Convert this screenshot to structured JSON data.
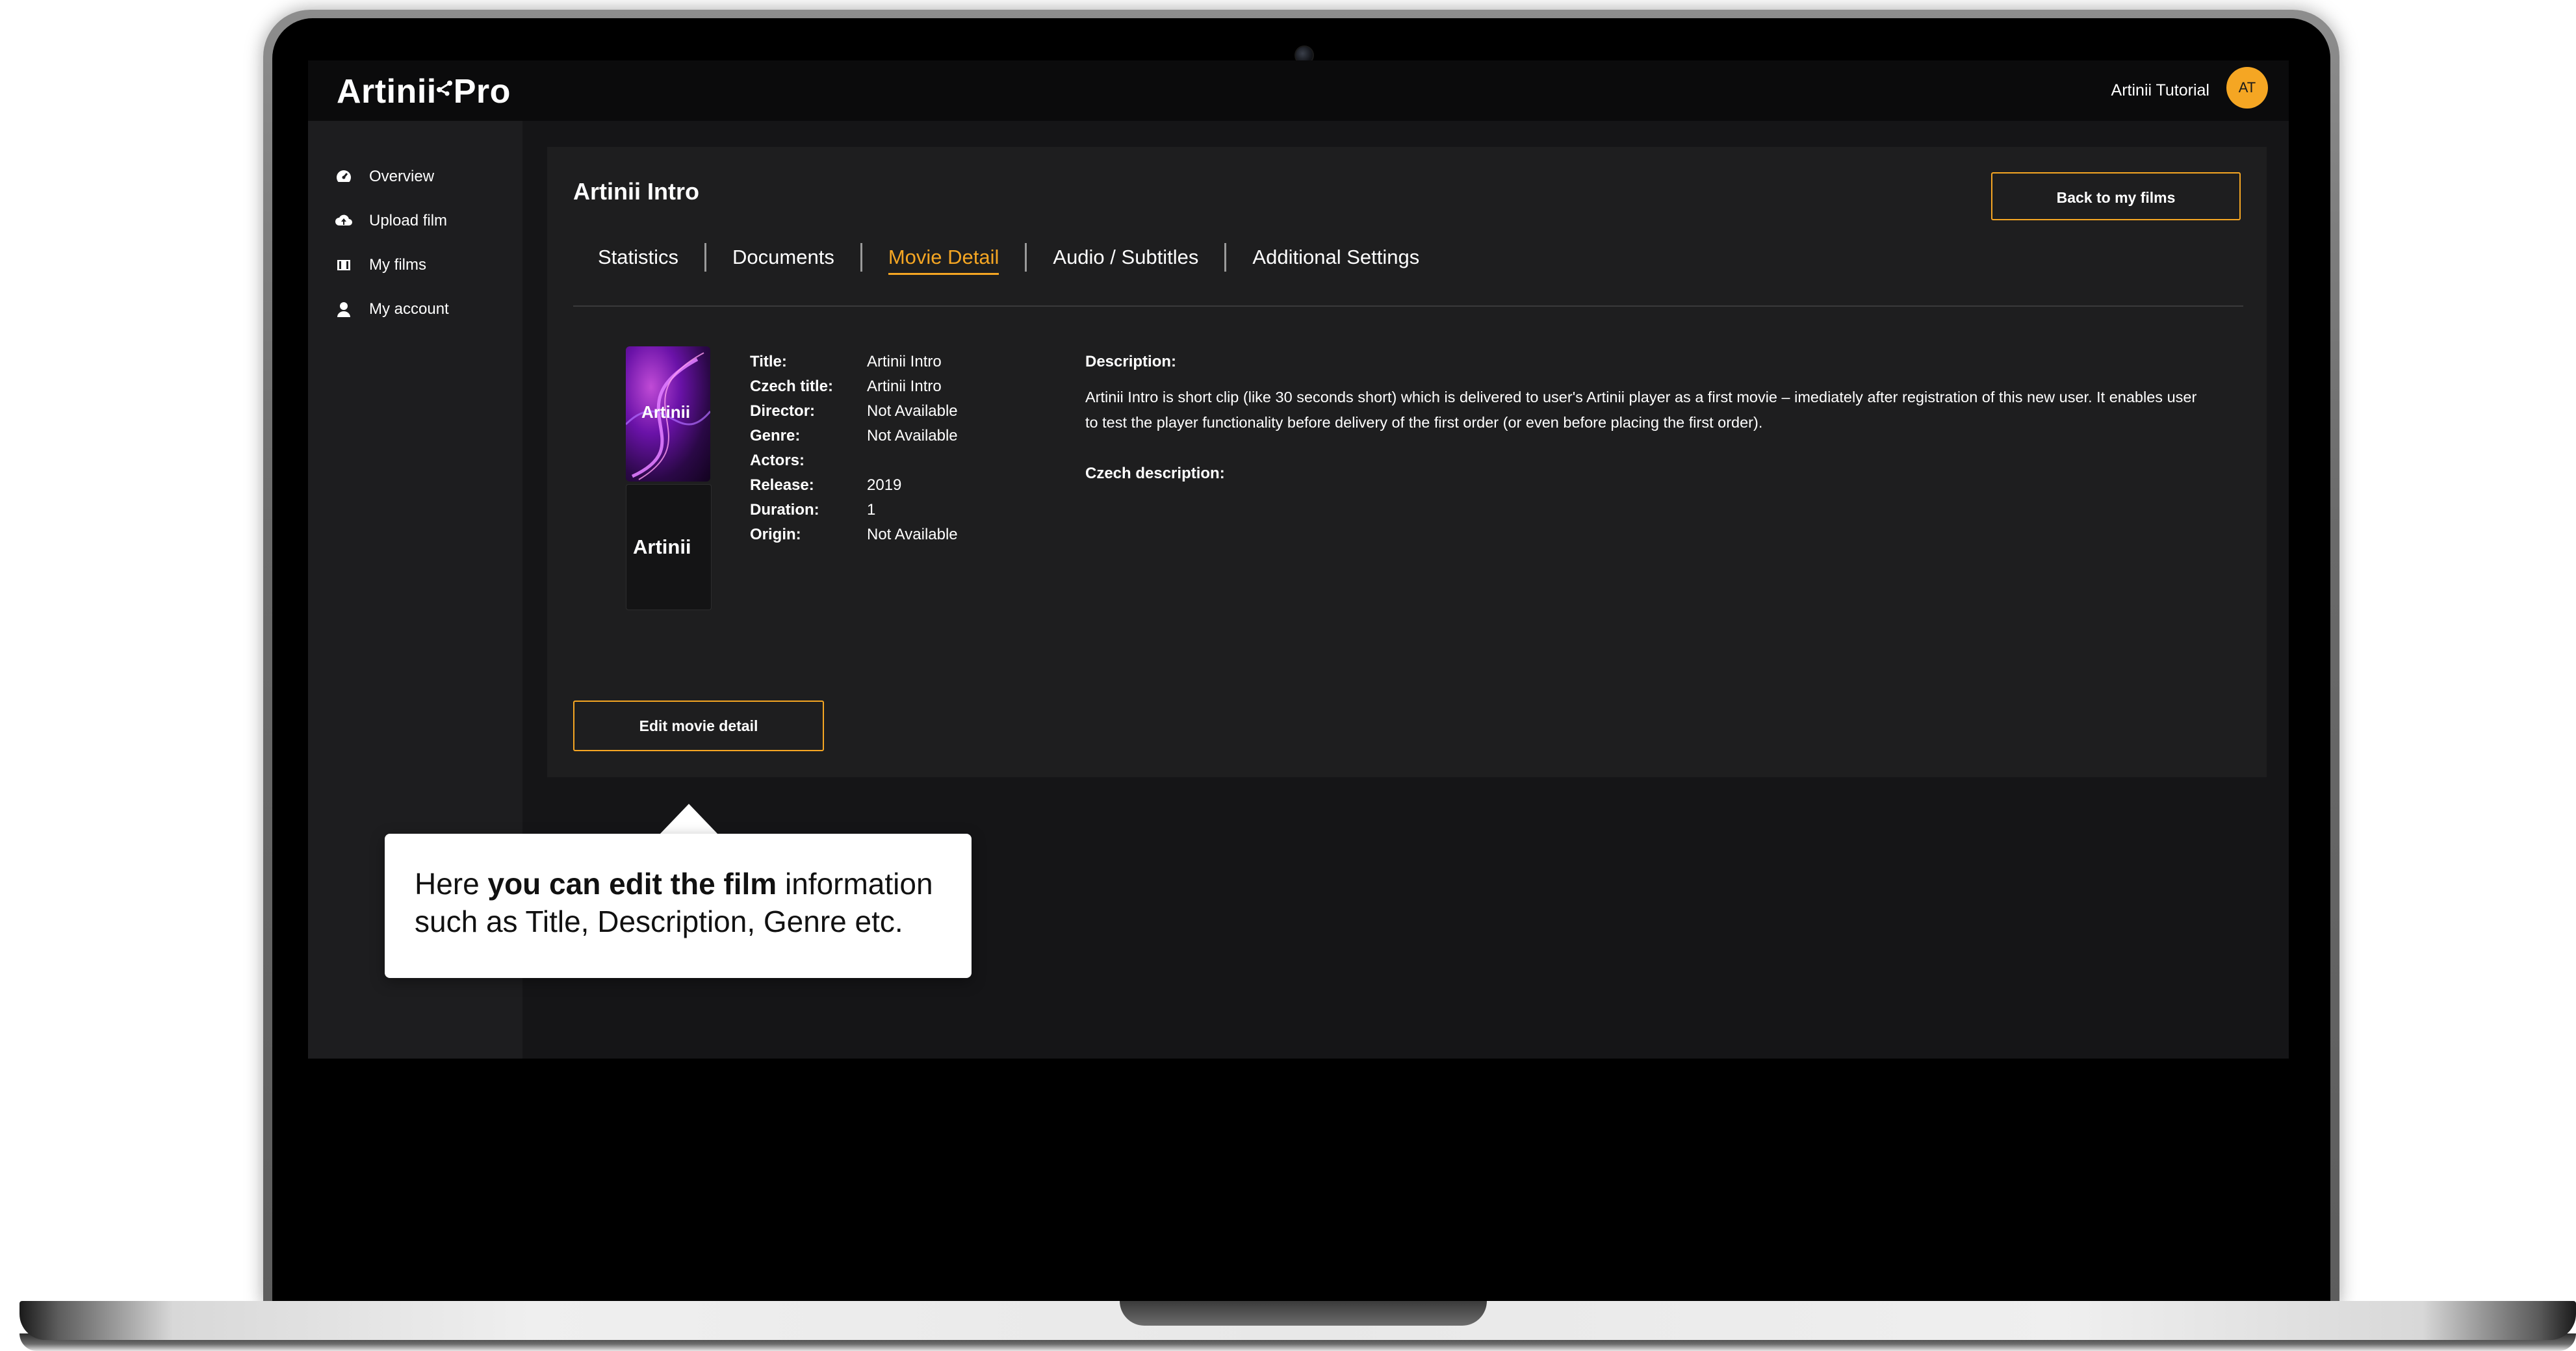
{
  "app": {
    "logo_text": "Artinii",
    "logo_suffix": "Pro",
    "user_name": "Artinii Tutorial",
    "avatar_initials": "AT"
  },
  "sidebar": {
    "items": [
      {
        "label": "Overview",
        "icon": "dashboard-icon"
      },
      {
        "label": "Upload film",
        "icon": "cloud-upload-icon"
      },
      {
        "label": "My films",
        "icon": "film-icon"
      },
      {
        "label": "My account",
        "icon": "user-icon"
      }
    ]
  },
  "film": {
    "title": "Artinii Intro",
    "back_button": "Back to my films",
    "tabs": [
      {
        "label": "Statistics",
        "active": false
      },
      {
        "label": "Documents",
        "active": false
      },
      {
        "label": "Movie Detail",
        "active": true
      },
      {
        "label": "Audio / Subtitles",
        "active": false
      },
      {
        "label": "Additional Settings",
        "active": false
      }
    ],
    "poster_text": "Artinii",
    "thumbnail_text": "Artinii",
    "details": [
      {
        "label": "Title:",
        "value": "Artinii Intro"
      },
      {
        "label": "Czech title:",
        "value": "Artinii Intro"
      },
      {
        "label": "Director:",
        "value": "Not Available"
      },
      {
        "label": "Genre:",
        "value": "Not Available"
      },
      {
        "label": "Actors:",
        "value": ""
      },
      {
        "label": "Release:",
        "value": "2019"
      },
      {
        "label": "Duration:",
        "value": "1"
      },
      {
        "label": "Origin:",
        "value": "Not Available"
      }
    ],
    "description_label": "Description:",
    "description": "Artinii Intro is short clip (like 30 seconds short) which is delivered to user's Artinii player as a first movie – imediately after registration of this new user. It enables user to test the player functionality before delivery of the first order (or even before placing the first order).",
    "czech_description_label": "Czech description:",
    "edit_button": "Edit movie detail"
  },
  "tooltip": {
    "part1": "Here ",
    "bold": "you can edit the film",
    "part2": " information such as Title, Description, Genre etc."
  },
  "colors": {
    "accent": "#f5a623",
    "screen_bg": "#151517",
    "panel_bg": "#1e1e1f",
    "sidebar_bg": "#1d1d1f",
    "topbar_bg": "#0b0b0c"
  }
}
